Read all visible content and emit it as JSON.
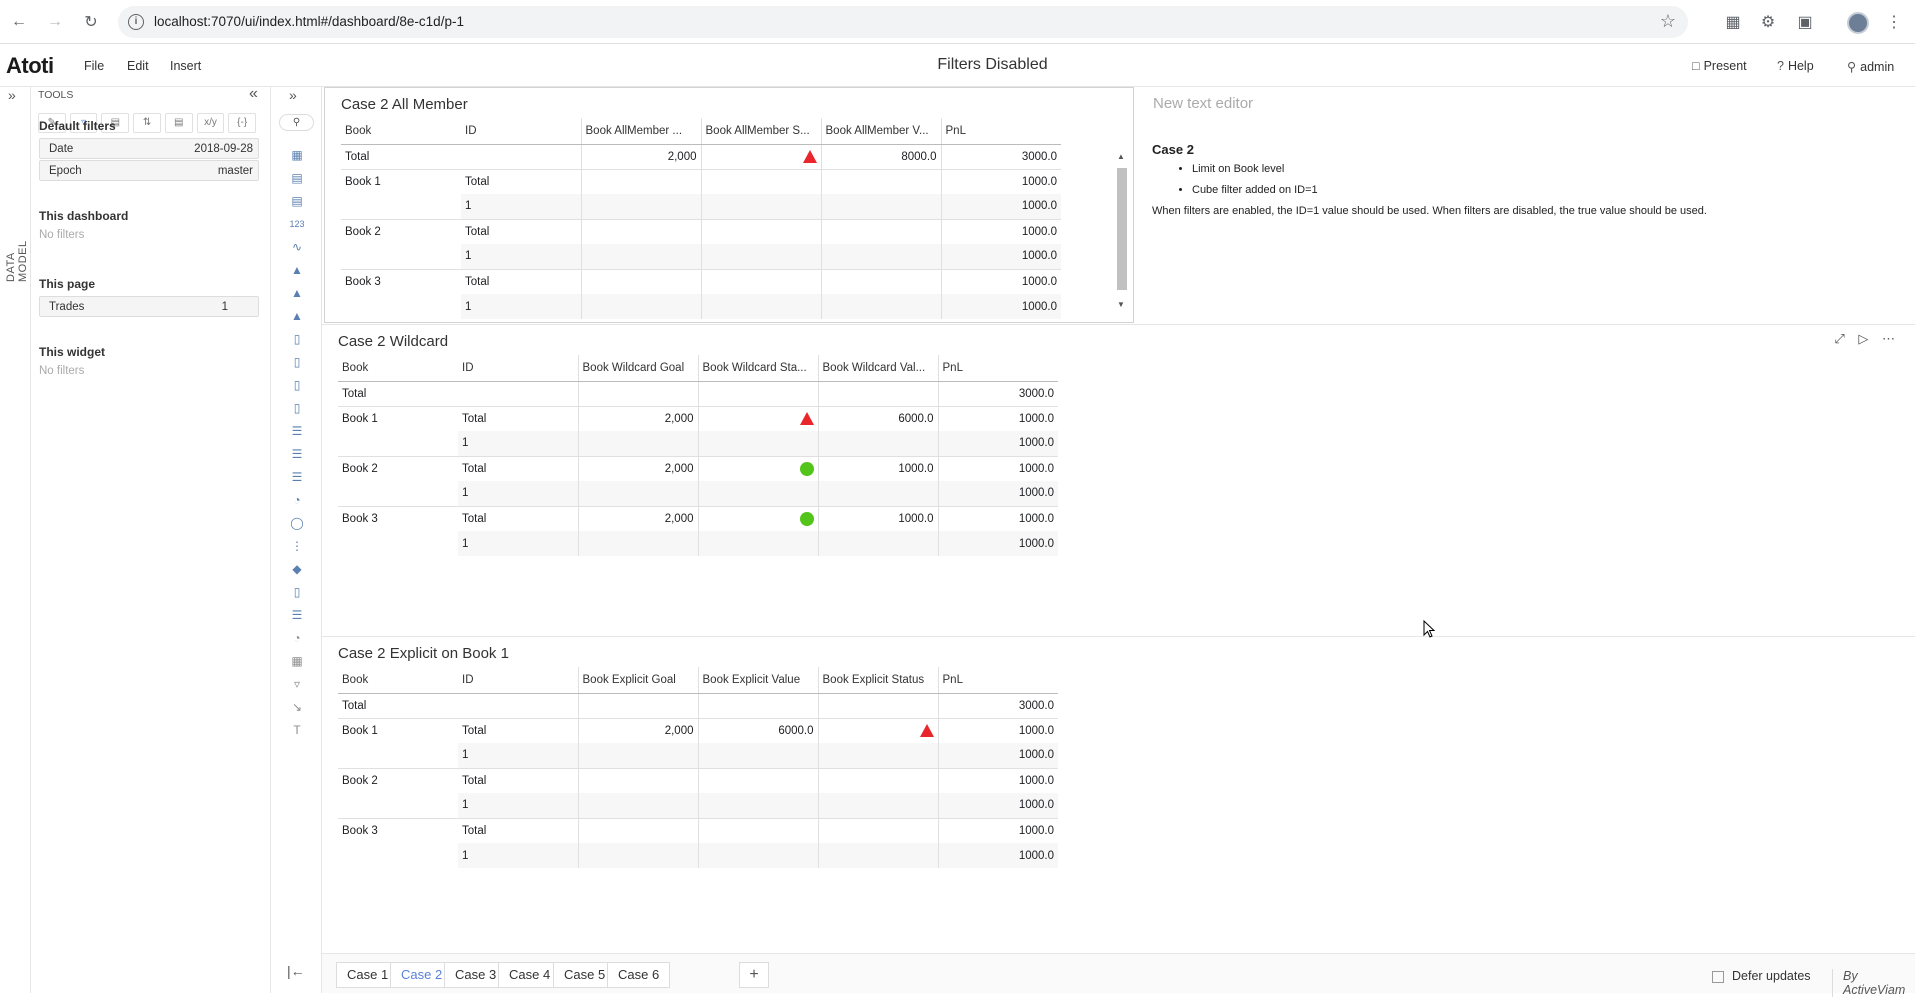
{
  "browser": {
    "url": "localhost:7070/ui/index.html#/dashboard/8e-c1d/p-1"
  },
  "app": {
    "logo": "Atoti",
    "menu": [
      "File",
      "Edit",
      "Insert"
    ],
    "title": "Filters Disabled",
    "present_label": "Present",
    "help_label": "Help",
    "user_label": "admin"
  },
  "data_model_label": "DATA MODEL",
  "filters_panel": {
    "tools_label": "TOOLS",
    "default_filters_title": "Default filters",
    "default_filters": [
      {
        "key": "Date",
        "value": "2018-09-28"
      },
      {
        "key": "Epoch",
        "value": "master"
      }
    ],
    "dashboard_title": "This dashboard",
    "dashboard_empty": "No filters",
    "page_title": "This page",
    "page_filters": [
      {
        "key": "Trades",
        "value": "1"
      }
    ],
    "widget_title": "This widget",
    "widget_empty": "No filters"
  },
  "widget1": {
    "title": "Case 2 All Member",
    "headers": [
      "Book",
      "ID",
      "Book AllMember ...",
      "Book AllMember S...",
      "Book AllMember V...",
      "PnL"
    ],
    "rows": [
      {
        "book": "Total",
        "id": "",
        "goal": "2,000",
        "status": "red-triangle",
        "value": "8000.0",
        "pnl": "3000.0"
      },
      {
        "book": "Book 1",
        "id": "Total",
        "goal": "",
        "status": "",
        "value": "",
        "pnl": "1000.0"
      },
      {
        "book": "",
        "id": "1",
        "goal": "",
        "status": "",
        "value": "",
        "pnl": "1000.0"
      },
      {
        "book": "Book 2",
        "id": "Total",
        "goal": "",
        "status": "",
        "value": "",
        "pnl": "1000.0"
      },
      {
        "book": "",
        "id": "1",
        "goal": "",
        "status": "",
        "value": "",
        "pnl": "1000.0"
      },
      {
        "book": "Book 3",
        "id": "Total",
        "goal": "",
        "status": "",
        "value": "",
        "pnl": "1000.0"
      },
      {
        "book": "",
        "id": "1",
        "goal": "",
        "status": "",
        "value": "",
        "pnl": "1000.0"
      }
    ]
  },
  "text_widget": {
    "title_placeholder": "New text editor",
    "heading": "Case 2",
    "bullets": [
      "Limit on Book level",
      "Cube filter added on ID=1"
    ],
    "paragraph": "When filters are enabled, the ID=1 value should be used. When filters are disabled, the true value should be used."
  },
  "widget2": {
    "title": "Case 2 Wildcard",
    "headers": [
      "Book",
      "ID",
      "Book Wildcard Goal",
      "Book Wildcard Sta...",
      "Book Wildcard Val...",
      "PnL"
    ],
    "rows": [
      {
        "book": "Total",
        "id": "",
        "goal": "",
        "status": "",
        "value": "",
        "pnl": "3000.0"
      },
      {
        "book": "Book 1",
        "id": "Total",
        "goal": "2,000",
        "status": "red-triangle",
        "value": "6000.0",
        "pnl": "1000.0"
      },
      {
        "book": "",
        "id": "1",
        "goal": "",
        "status": "",
        "value": "",
        "pnl": "1000.0"
      },
      {
        "book": "Book 2",
        "id": "Total",
        "goal": "2,000",
        "status": "green-circle",
        "value": "1000.0",
        "pnl": "1000.0"
      },
      {
        "book": "",
        "id": "1",
        "goal": "",
        "status": "",
        "value": "",
        "pnl": "1000.0"
      },
      {
        "book": "Book 3",
        "id": "Total",
        "goal": "2,000",
        "status": "green-circle",
        "value": "1000.0",
        "pnl": "1000.0"
      },
      {
        "book": "",
        "id": "1",
        "goal": "",
        "status": "",
        "value": "",
        "pnl": "1000.0"
      }
    ]
  },
  "widget3": {
    "title": "Case 2 Explicit on Book 1",
    "headers": [
      "Book",
      "ID",
      "Book Explicit Goal",
      "Book Explicit Value",
      "Book Explicit Status",
      "PnL"
    ],
    "rows": [
      {
        "book": "Total",
        "id": "",
        "goal": "",
        "value": "",
        "status": "",
        "pnl": "3000.0"
      },
      {
        "book": "Book 1",
        "id": "Total",
        "goal": "2,000",
        "value": "6000.0",
        "status": "red-triangle",
        "pnl": "1000.0"
      },
      {
        "book": "",
        "id": "1",
        "goal": "",
        "value": "",
        "status": "",
        "pnl": "1000.0"
      },
      {
        "book": "Book 2",
        "id": "Total",
        "goal": "",
        "value": "",
        "status": "",
        "pnl": "1000.0"
      },
      {
        "book": "",
        "id": "1",
        "goal": "",
        "value": "",
        "status": "",
        "pnl": "1000.0"
      },
      {
        "book": "Book 3",
        "id": "Total",
        "goal": "",
        "value": "",
        "status": "",
        "pnl": "1000.0"
      },
      {
        "book": "",
        "id": "1",
        "goal": "",
        "value": "",
        "status": "",
        "pnl": "1000.0"
      }
    ]
  },
  "tabs": [
    "Case 1",
    "Case 2",
    "Case 3",
    "Case 4",
    "Case 5",
    "Case 6"
  ],
  "active_tab": "Case 2",
  "defer_label": "Defer updates",
  "by_label": "By ActiveViam",
  "colors": {
    "accent": "#5a7fd6",
    "red": "#e8262b",
    "green": "#52c41a"
  }
}
